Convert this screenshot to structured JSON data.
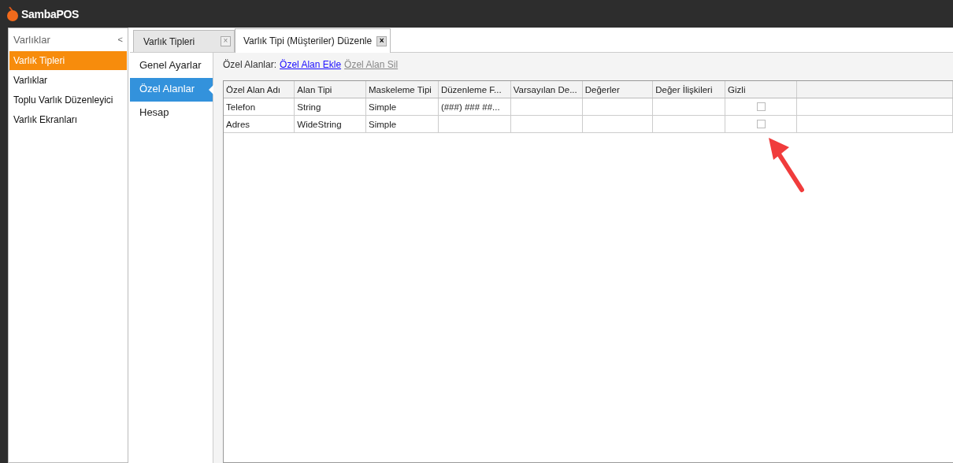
{
  "app": {
    "title": "SambaPOS"
  },
  "sidebar": {
    "title": "Varlıklar",
    "collapse": "<",
    "items": [
      {
        "label": "Varlık Tipleri",
        "selected": true
      },
      {
        "label": "Varlıklar",
        "selected": false
      },
      {
        "label": "Toplu Varlık Düzenleyici",
        "selected": false
      },
      {
        "label": "Varlık Ekranları",
        "selected": false
      }
    ]
  },
  "tabs": [
    {
      "label": "Varlık Tipleri",
      "close": "×",
      "selected": false
    },
    {
      "label": "Varlık Tipi (Müşteriler) Düzenle",
      "close": "×",
      "selected": true
    }
  ],
  "sections": [
    {
      "label": "Genel Ayarlar",
      "selected": false
    },
    {
      "label": "Özel Alanlar",
      "selected": true
    },
    {
      "label": "Hesap",
      "selected": false
    }
  ],
  "toolbar": {
    "label": "Özel Alanlar:",
    "links": [
      {
        "label": "Özel Alan Ekle",
        "disabled": false
      },
      {
        "label": "Özel Alan Sil",
        "disabled": true
      }
    ]
  },
  "table": {
    "columns": [
      "Özel Alan Adı",
      "Alan Tipi",
      "Maskeleme Tipi",
      "Düzenleme F...",
      "Varsayılan De...",
      "Değerler",
      "Değer İlişkileri",
      "Gizli"
    ],
    "rows": [
      {
        "name": "Telefon",
        "type": "String",
        "mask": "Simple",
        "edit_format": "(###) ### ##...",
        "hidden": false
      },
      {
        "name": "Adres",
        "type": "WideString",
        "mask": "Simple",
        "hidden": false
      }
    ]
  }
}
